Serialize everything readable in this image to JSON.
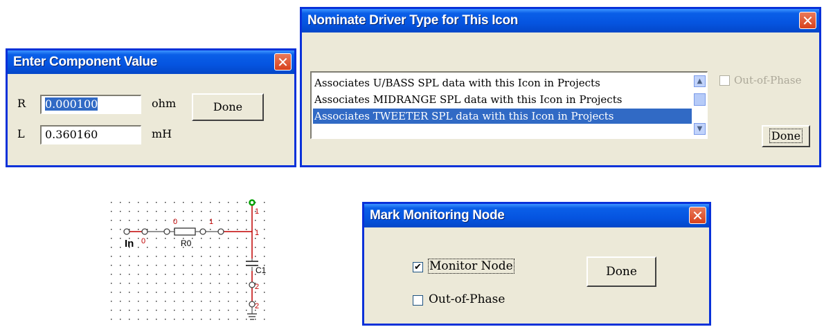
{
  "component_dialog": {
    "title": "Enter Component Value",
    "r_label": "R",
    "r_value": "0.000100",
    "r_unit": "ohm",
    "l_label": "L",
    "l_value": "0.360160",
    "l_unit": "mH",
    "done_label": "Done",
    "close_glyph": "✕"
  },
  "driver_dialog": {
    "title": "Nominate Driver Type for This Icon",
    "options": [
      "Associates U/BASS SPL data with this Icon in Projects",
      "Associates MIDRANGE SPL data with this Icon in Projects",
      "Associates TWEETER SPL data with this Icon in Projects"
    ],
    "selected_index": 2,
    "out_of_phase_label": "Out-of-Phase",
    "out_of_phase_checked": false,
    "done_label": "Done",
    "close_glyph": "✕"
  },
  "circuit": {
    "input_label": "In",
    "input_node": "0",
    "resistor_label": "R0",
    "resistor_node_left": "0",
    "resistor_node_right": "1",
    "capacitor_label": "C1",
    "node_top": "1",
    "node_mid": "1",
    "node_lower": "2",
    "node_bottom": "2",
    "wire_color": "#c00000",
    "monitor_color": "#00a000"
  },
  "monitor_dialog": {
    "title": "Mark Monitoring Node",
    "monitor_label": "Monitor Node",
    "monitor_checked": true,
    "out_of_phase_label": "Out-of-Phase",
    "out_of_phase_checked": false,
    "done_label": "Done",
    "check_glyph": "✔",
    "close_glyph": "✕"
  },
  "colors": {
    "titlebar_blue": "#0554e0",
    "dialog_face": "#ece9d8",
    "selection": "#316ac5",
    "close_red": "#d8411c"
  }
}
